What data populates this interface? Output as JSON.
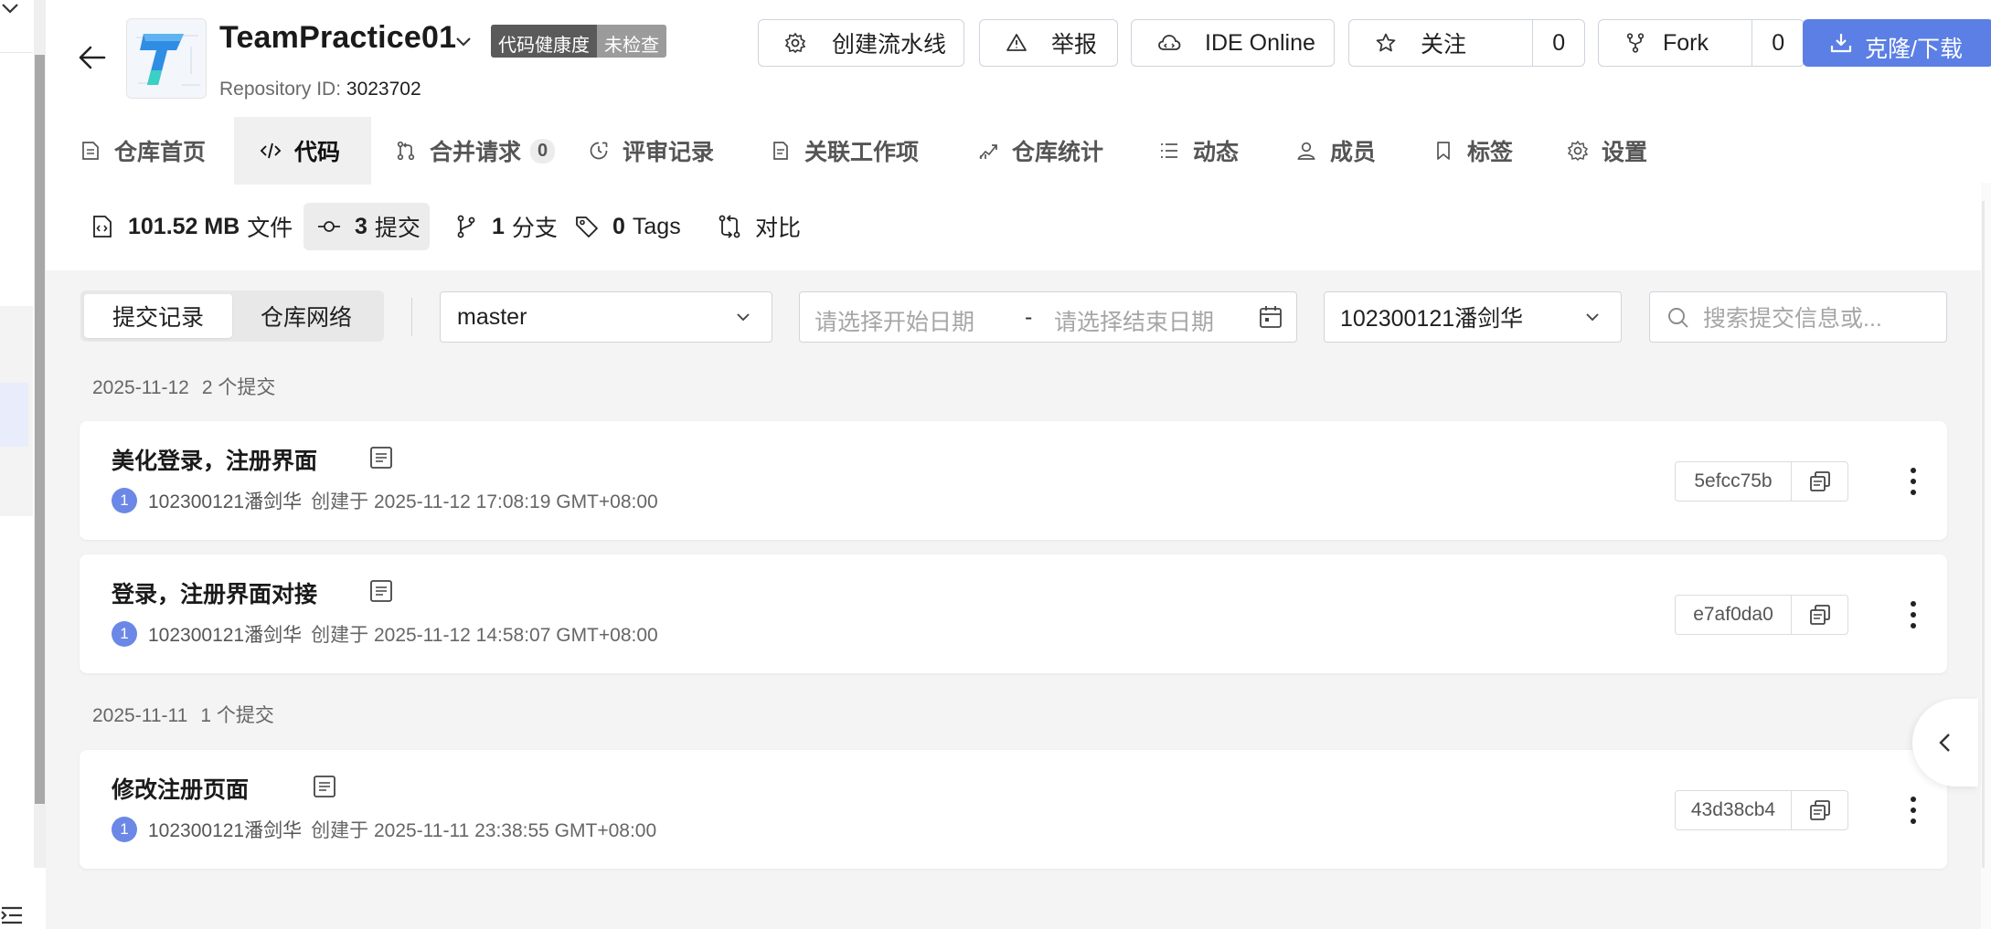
{
  "repo": {
    "name": "TeamPractice01",
    "health_label": "代码健康度",
    "health_status": "未检查",
    "id_label": "Repository ID:",
    "id_value": "3023702"
  },
  "header_actions": {
    "pipeline": "创建流水线",
    "report": "举报",
    "ide": "IDE Online",
    "watch": "关注",
    "watch_count": "0",
    "fork": "Fork",
    "fork_count": "0",
    "clone": "克隆/下载"
  },
  "tabs": [
    {
      "label": "仓库首页",
      "icon": "file-icon"
    },
    {
      "label": "代码",
      "icon": "code-icon",
      "active": true
    },
    {
      "label": "合并请求",
      "icon": "merge-request-icon",
      "badge": "0"
    },
    {
      "label": "评审记录",
      "icon": "review-icon"
    },
    {
      "label": "关联工作项",
      "icon": "document-icon"
    },
    {
      "label": "仓库统计",
      "icon": "stats-icon"
    },
    {
      "label": "动态",
      "icon": "list-icon"
    },
    {
      "label": "成员",
      "icon": "user-icon"
    },
    {
      "label": "标签",
      "icon": "bookmark-icon"
    },
    {
      "label": "设置",
      "icon": "settings-icon"
    }
  ],
  "subnav": {
    "files_value": "101.52 MB",
    "files_label": "文件",
    "commits_value": "3",
    "commits_label": "提交",
    "branches_value": "1",
    "branches_label": "分支",
    "tags_value": "0",
    "tags_label": "Tags",
    "compare_label": "对比"
  },
  "filters": {
    "view_commits": "提交记录",
    "view_network": "仓库网络",
    "branch": "master",
    "start_date_placeholder": "请选择开始日期",
    "date_separator": "-",
    "end_date_placeholder": "请选择结束日期",
    "author": "102300121潘剑华",
    "search_placeholder": "搜索提交信息或..."
  },
  "commit_groups": [
    {
      "date": "2025-11-12",
      "count_label": "2 个提交",
      "commits": [
        {
          "title": "美化登录，注册界面",
          "avatar": "1",
          "author": "102300121潘剑华",
          "created": "创建于 2025-11-12 17:08:19 GMT+08:00",
          "sha": "5efcc75b"
        },
        {
          "title": "登录，注册界面对接",
          "avatar": "1",
          "author": "102300121潘剑华",
          "created": "创建于 2025-11-12 14:58:07 GMT+08:00",
          "sha": "e7af0da0"
        }
      ]
    },
    {
      "date": "2025-11-11",
      "count_label": "1 个提交",
      "commits": [
        {
          "title": "修改注册页面",
          "avatar": "1",
          "author": "102300121潘剑华",
          "created": "创建于 2025-11-11 23:38:55 GMT+08:00",
          "sha": "43d38cb4"
        }
      ]
    }
  ],
  "colors": {
    "primary": "#5b7fe4",
    "avatar": "#6b88e6",
    "badge_dark": "#5a5a5a",
    "badge_light": "#9b9b9b",
    "page_bg": "#f4f4f4"
  }
}
